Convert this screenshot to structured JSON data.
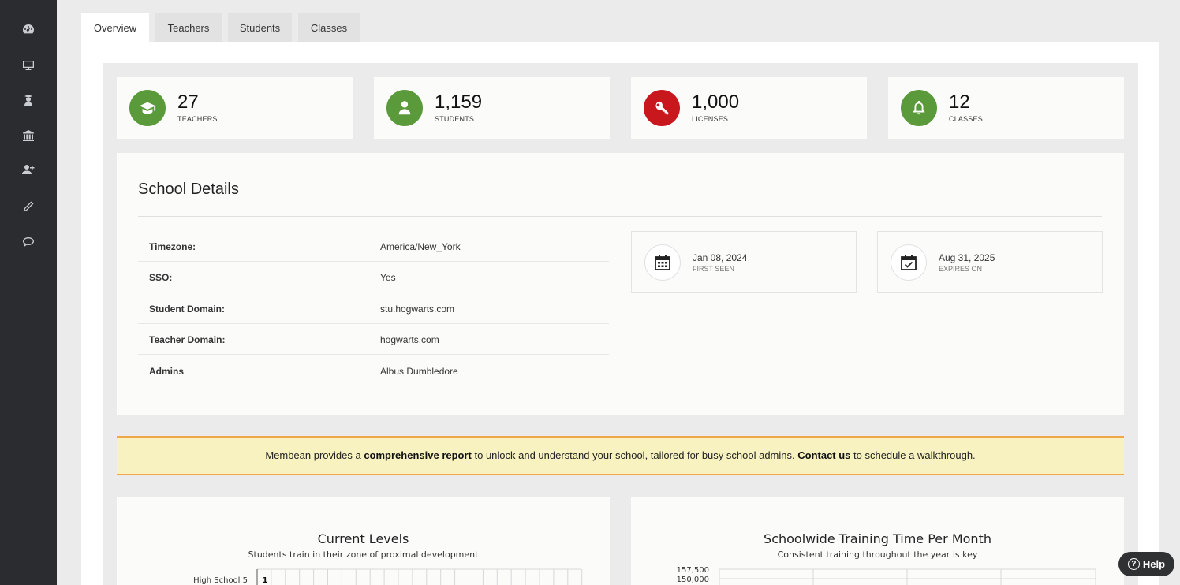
{
  "sidebar": {
    "items": [
      {
        "icon": "dashboard-icon"
      },
      {
        "icon": "monitor-icon"
      },
      {
        "icon": "student-icon"
      },
      {
        "icon": "school-building-icon"
      },
      {
        "icon": "add-user-icon"
      },
      {
        "icon": "pencil-icon"
      },
      {
        "icon": "chat-bubble-icon"
      }
    ]
  },
  "tabs": [
    {
      "label": "Overview",
      "active": true
    },
    {
      "label": "Teachers"
    },
    {
      "label": "Students"
    },
    {
      "label": "Classes"
    }
  ],
  "stats": [
    {
      "value": "27",
      "label": "TEACHERS",
      "icon": "graduation-cap-icon",
      "color": "#5a9a3a"
    },
    {
      "value": "1,159",
      "label": "STUDENTS",
      "icon": "user-icon",
      "color": "#5a9a3a"
    },
    {
      "value": "1,000",
      "label": "LICENSES",
      "icon": "key-icon",
      "color": "#c8181e"
    },
    {
      "value": "12",
      "label": "CLASSES",
      "icon": "bell-icon",
      "color": "#5a9a3a"
    }
  ],
  "school_details": {
    "title": "School Details",
    "rows": [
      {
        "key": "Timezone:",
        "value": "America/New_York"
      },
      {
        "key": "SSO:",
        "value": "Yes"
      },
      {
        "key": "Student Domain:",
        "value": "stu.hogwarts.com"
      },
      {
        "key": "Teacher Domain:",
        "value": "hogwarts.com"
      },
      {
        "key": "Admins",
        "value": "Albus Dumbledore"
      }
    ],
    "first_seen": {
      "date": "Jan 08, 2024",
      "label": "FIRST SEEN"
    },
    "expires_on": {
      "date": "Aug 31, 2025",
      "label": "EXPIRES ON"
    }
  },
  "banner": {
    "text1": "Membean provides a ",
    "link1": "comprehensive report",
    "text2": " to unlock and understand your school, tailored for busy school admins. ",
    "link2": "Contact us",
    "text3": " to schedule a walkthrough."
  },
  "charts": {
    "levels": {
      "title": "Current Levels",
      "subtitle": "Students train in their zone of proximal development",
      "row_label": "High School 5",
      "first_value": "1"
    },
    "training": {
      "title": "Schoolwide Training Time Per Month",
      "subtitle": "Consistent training throughout the year is key",
      "tick_1": "157,500",
      "tick_2": "150,000"
    }
  },
  "chart_data": [
    {
      "type": "heatmap",
      "title": "Current Levels",
      "subtitle": "Students train in their zone of proximal development",
      "categories": [
        "High School 5"
      ],
      "values": [
        [
          1
        ]
      ]
    },
    {
      "type": "line",
      "title": "Schoolwide Training Time Per Month",
      "subtitle": "Consistent training throughout the year is key",
      "y_ticks": [
        "157,500",
        "150,000"
      ]
    }
  ],
  "help": {
    "label": "Help",
    "icon": "question-circle-icon"
  },
  "colors": {
    "green": "#5a9a3a",
    "red": "#c8181e",
    "banner_bg": "#f7f2c0",
    "banner_border": "#f0a64a",
    "sidebar": "#2a2c2f"
  }
}
